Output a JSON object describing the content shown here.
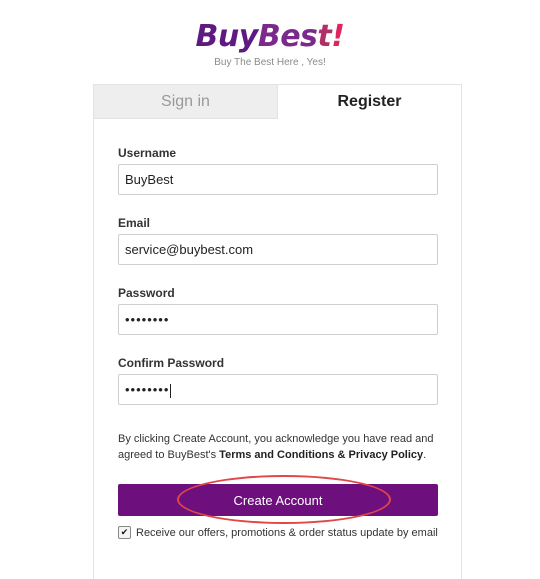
{
  "brand": {
    "logo_buy": "Buy",
    "logo_best": "Bes",
    "logo_t": "t",
    "logo_bang": "!",
    "tagline": "Buy The Best Here , Yes!"
  },
  "tabs": [
    {
      "label": "Sign in",
      "active": false
    },
    {
      "label": "Register",
      "active": true
    }
  ],
  "form": {
    "username": {
      "label": "Username",
      "value": "BuyBest"
    },
    "email": {
      "label": "Email",
      "value": "service@buybest.com"
    },
    "password": {
      "label": "Password",
      "masked_value": "••••••••"
    },
    "confirm_password": {
      "label": "Confirm Password",
      "masked_value": "••••••••"
    }
  },
  "legal": {
    "prefix": "By clicking Create Account, you acknowledge you have read and agreed to BuyBest's ",
    "terms_link": "Terms and Conditions",
    "joiner": " & ",
    "privacy_link": "Privacy Policy",
    "suffix": "."
  },
  "create_button": {
    "label": "Create Account",
    "color": "#6d0f7d"
  },
  "optin": {
    "checked": true,
    "check_glyph": "✔",
    "label": "Receive our offers, promotions & order status update by email"
  },
  "colors": {
    "brand_purple": "#5e1a82",
    "accent_pink": "#e0245e",
    "annotation_red": "#e04848"
  }
}
